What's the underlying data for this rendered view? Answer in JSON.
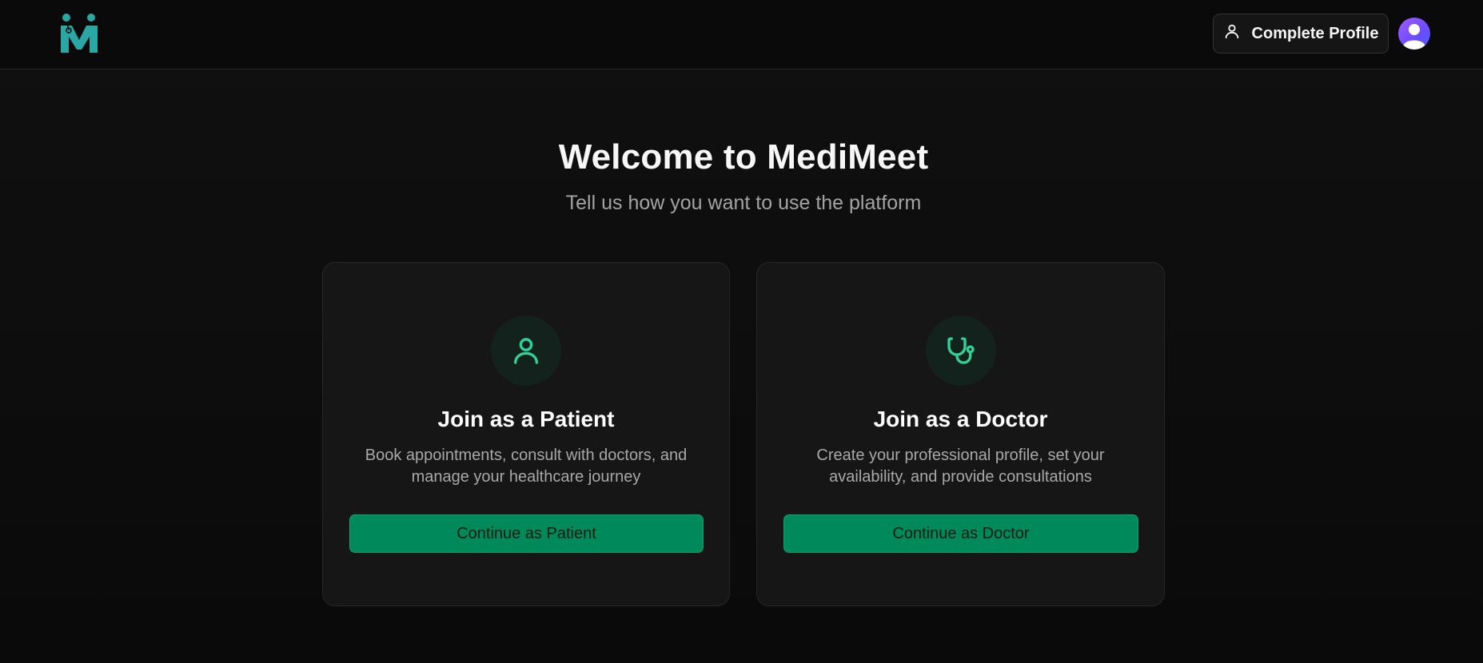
{
  "header": {
    "logo_icon": "medimeet-logo-icon",
    "profile_button_label": "Complete Profile",
    "profile_button_icon": "user-icon",
    "avatar_icon": "user-avatar-icon"
  },
  "hero": {
    "title": "Welcome to MediMeet",
    "subtitle": "Tell us how you want to use the platform"
  },
  "cards": [
    {
      "icon": "user-icon",
      "title": "Join as a Patient",
      "description": "Book appointments, consult with doctors, and manage your healthcare journey",
      "button_label": "Continue as Patient"
    },
    {
      "icon": "stethoscope-icon",
      "title": "Join as a Doctor",
      "description": "Create your professional profile, set your availability, and provide consultations",
      "button_label": "Continue as Doctor"
    }
  ],
  "colors": {
    "accent": "#008a5c",
    "icon_green": "#2fd39a",
    "logo_teal": "#2aa7a4",
    "avatar_purple": "#7b4cff",
    "background": "#0b0b0b",
    "card": "#161616"
  }
}
